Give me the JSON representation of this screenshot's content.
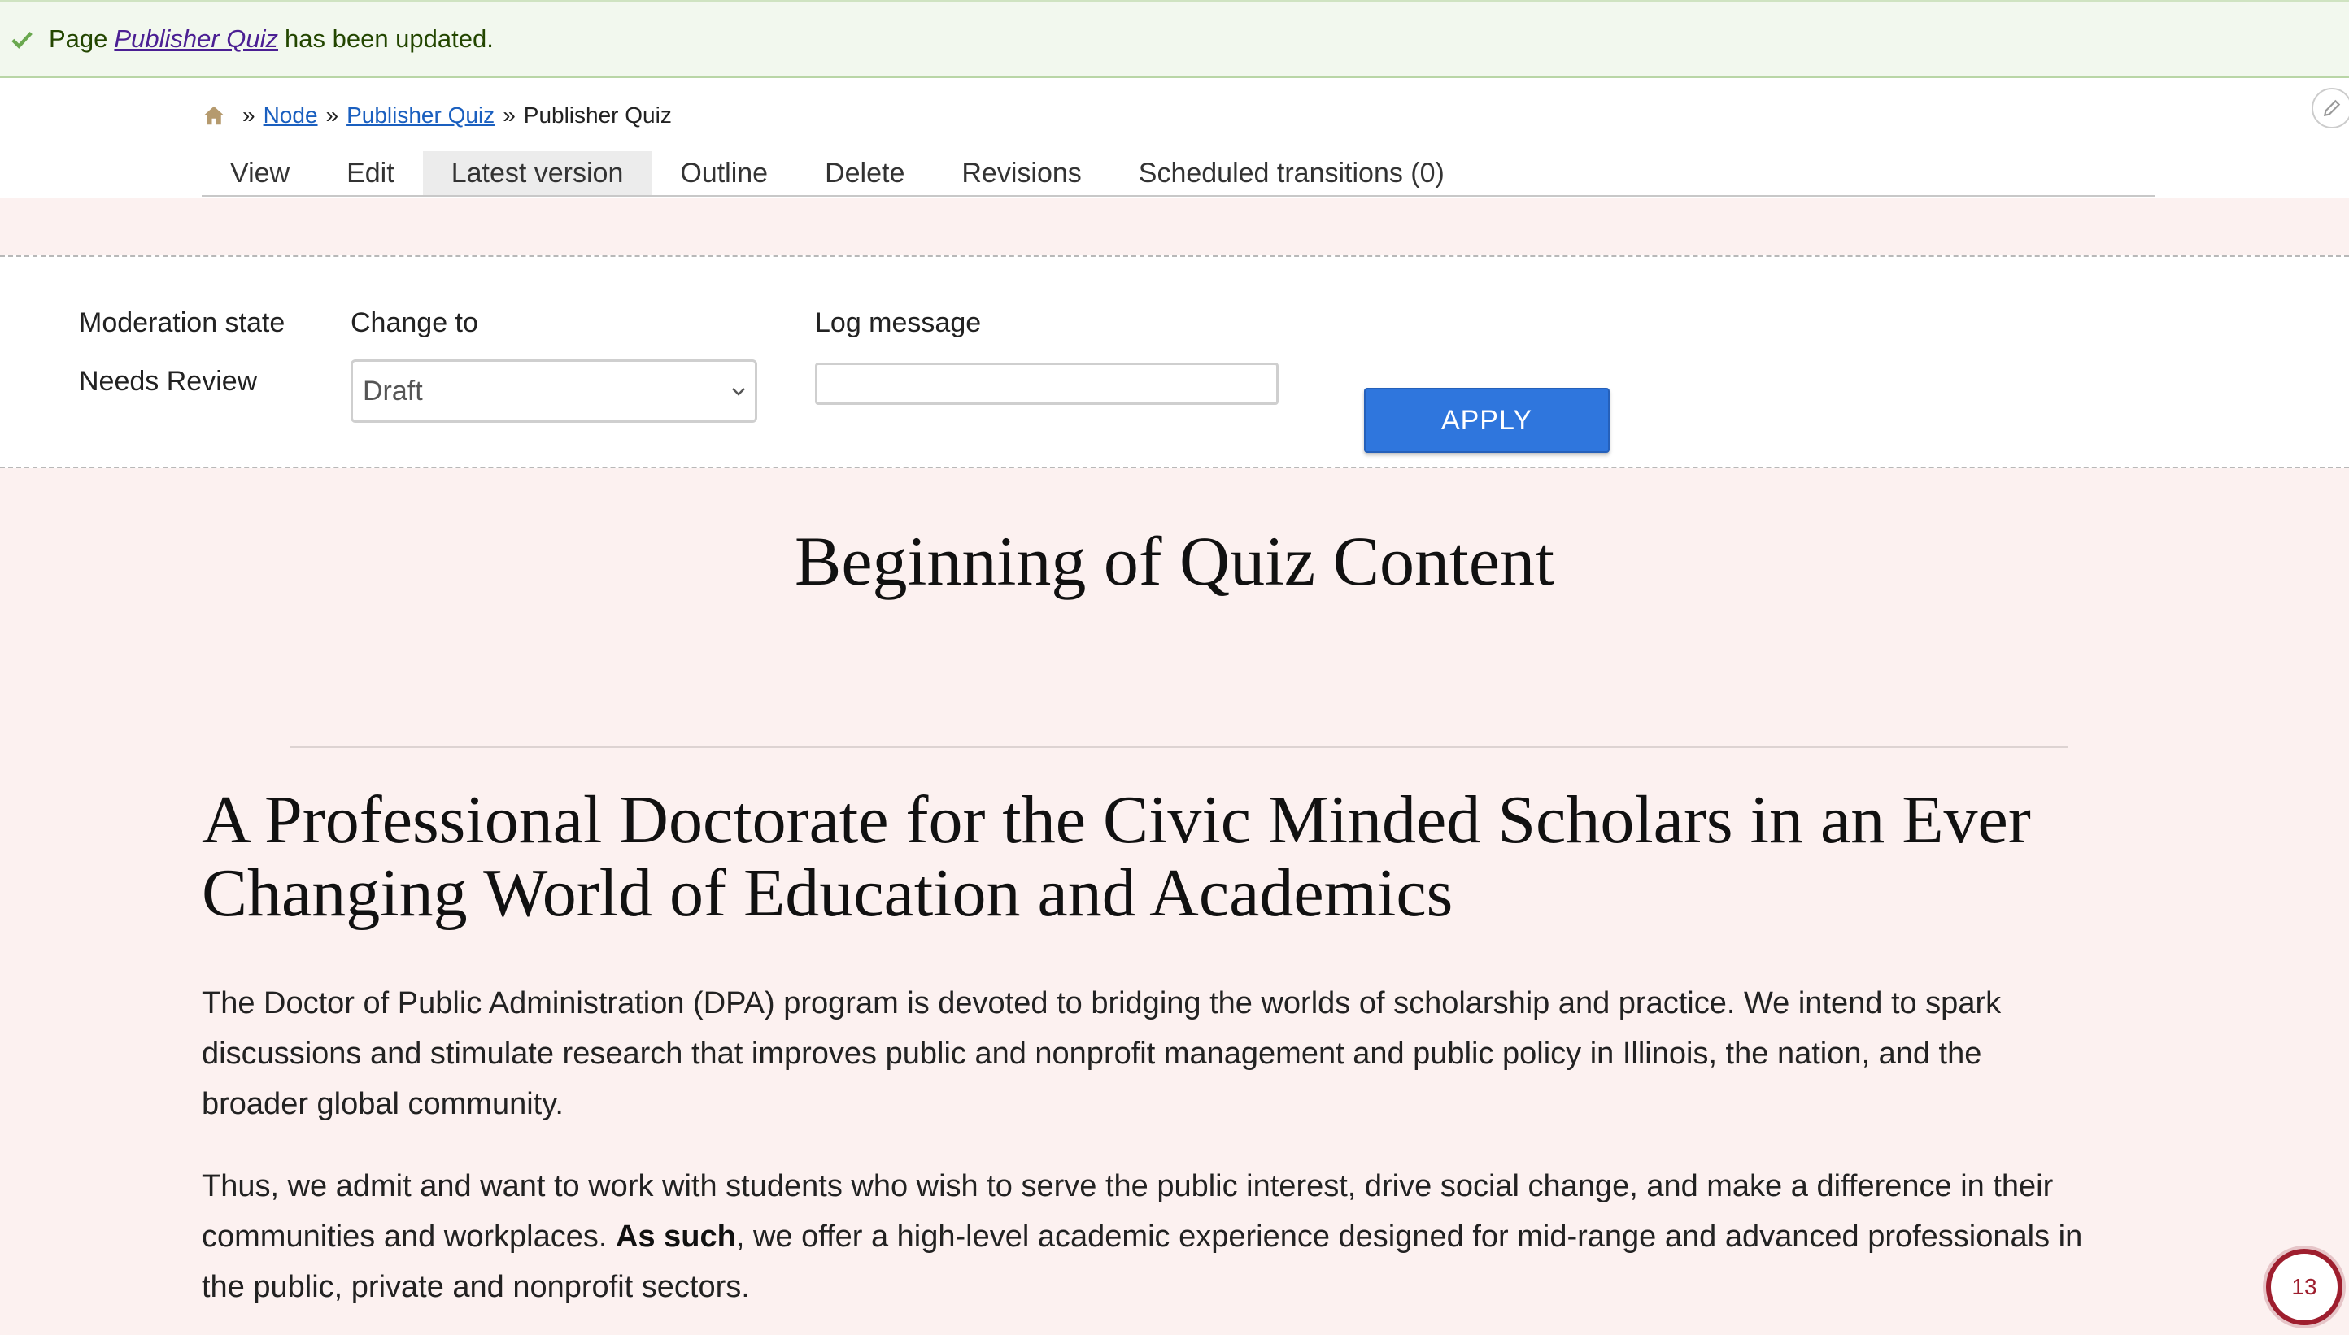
{
  "status": {
    "prefix": "Page",
    "link_text": "Publisher Quiz",
    "suffix": "has been updated."
  },
  "breadcrumb": {
    "sep": "»",
    "items": [
      "Node",
      "Publisher Quiz"
    ],
    "current": "Publisher Quiz"
  },
  "tabs": [
    {
      "label": "View"
    },
    {
      "label": "Edit"
    },
    {
      "label": "Latest version",
      "active": true
    },
    {
      "label": "Outline"
    },
    {
      "label": "Delete"
    },
    {
      "label": "Revisions"
    },
    {
      "label": "Scheduled transitions (0)"
    }
  ],
  "moderation": {
    "state_label": "Moderation state",
    "state_value": "Needs Review",
    "change_to_label": "Change to",
    "change_to_value": "Draft",
    "log_label": "Log message",
    "log_value": "",
    "apply_label": "APPLY"
  },
  "content": {
    "title": "Beginning of Quiz Content",
    "heading_line1": "A Professional Doctorate for the Civic Minded Scholars in an Ever",
    "heading_line2": "Changing World of Education and Academics",
    "para1_line1": "The Doctor of Public Administration (DPA) program is devoted to bridging the worlds of scholarship and practice. We intend to spark",
    "para1_line2": "discussions and stimulate research that improves public and nonprofit management and public policy in Illinois, the nation, and the",
    "para1_line3": "broader global community.",
    "para2_line1": "Thus, we admit and want to work with students who wish to serve the public interest, drive social change, and make a difference in their",
    "para2_line2_pre": "communities and workplaces. ",
    "para2_line2_bold": "As such",
    "para2_line2_post": ", we offer a high-level academic experience designed for mid-range and advanced professionals in",
    "para2_line3": "the public, private and nonprofit sectors."
  },
  "badge": {
    "count": "13"
  },
  "colors": {
    "status_bg": "#f2f8ee",
    "page_bg": "#fcf1f0",
    "apply_button": "#2f76dd",
    "badge_ring": "#9e1e2e",
    "link": "#1a5fbf"
  },
  "icons": {
    "status": "check-icon",
    "breadcrumb_home": "home-icon",
    "edit": "pencil-icon",
    "select": "chevron-down-icon"
  }
}
